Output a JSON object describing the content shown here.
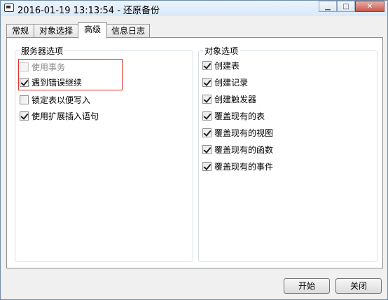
{
  "window": {
    "title": "2016-01-19 13:13:54 - 还原备份"
  },
  "tabs": [
    {
      "label": "常规"
    },
    {
      "label": "对象选择"
    },
    {
      "label": "高级",
      "active": true
    },
    {
      "label": "信息日志"
    }
  ],
  "server_options": {
    "title": "服务器选项",
    "items": [
      {
        "label": "使用事务",
        "checked": false,
        "disabled": true
      },
      {
        "label": "遇到错误继续",
        "checked": true
      },
      {
        "label": "锁定表以便写入",
        "checked": false
      },
      {
        "label": "使用扩展插入语句",
        "checked": true
      }
    ]
  },
  "object_options": {
    "title": "对象选项",
    "items": [
      {
        "label": "创建表",
        "checked": true
      },
      {
        "label": "创建记录",
        "checked": true
      },
      {
        "label": "创建触发器",
        "checked": true
      },
      {
        "label": "覆盖现有的表",
        "checked": true
      },
      {
        "label": "覆盖现有的视图",
        "checked": true
      },
      {
        "label": "覆盖现有的函数",
        "checked": true
      },
      {
        "label": "覆盖现有的事件",
        "checked": true
      }
    ]
  },
  "buttons": {
    "start": "开始",
    "close": "关闭"
  },
  "colors": {
    "highlight_box": "#e0302c"
  }
}
